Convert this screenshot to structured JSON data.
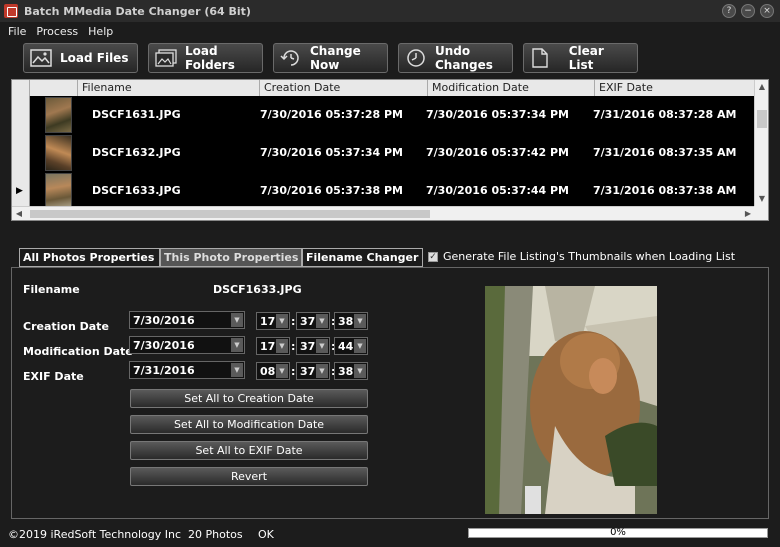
{
  "window": {
    "title": "Batch MMedia Date Changer (64 Bit)",
    "controls": [
      "?",
      "−",
      "×"
    ]
  },
  "menu": [
    "File",
    "Process",
    "Help"
  ],
  "toolbar": {
    "load_files": "Load Files",
    "load_folders": "Load Folders",
    "change_now": "Change Now",
    "undo_changes": "Undo Changes",
    "clear_list": "Clear List"
  },
  "file_list": {
    "columns": [
      "Filename",
      "Creation Date",
      "Modification Date",
      "EXIF Date"
    ],
    "rows": [
      {
        "filename": "DSCF1631.JPG",
        "creation": "7/30/2016 05:37:28 PM",
        "modification": "7/30/2016 05:37:34 PM",
        "exif": "7/31/2016 08:37:28 AM"
      },
      {
        "filename": "DSCF1632.JPG",
        "creation": "7/30/2016 05:37:34 PM",
        "modification": "7/30/2016 05:37:42 PM",
        "exif": "7/31/2016 08:37:35 AM"
      },
      {
        "filename": "DSCF1633.JPG",
        "creation": "7/30/2016 05:37:38 PM",
        "modification": "7/30/2016 05:37:44 PM",
        "exif": "7/31/2016 08:37:38 AM"
      }
    ],
    "current_row_index": 2
  },
  "tabs": [
    "All Photos Properties",
    "This Photo Properties",
    "Filename Changer"
  ],
  "active_tab": "This Photo Properties",
  "generate_thumbnails": {
    "label": "Generate File Listing's Thumbnails when Loading List",
    "checked": true
  },
  "properties": {
    "filename_label": "Filename",
    "filename_value": "DSCF1633.JPG",
    "creation": {
      "label": "Creation Date",
      "date": "7/30/2016",
      "hour": "17",
      "minute": "37",
      "second": "38"
    },
    "modification": {
      "label": "Modification Date",
      "date": "7/30/2016",
      "hour": "17",
      "minute": "37",
      "second": "44"
    },
    "exif": {
      "label": "EXIF Date",
      "date": "7/31/2016",
      "hour": "08",
      "minute": "37",
      "second": "38"
    },
    "buttons": {
      "set_creation": "Set All to Creation Date",
      "set_modification": "Set All to Modification Date",
      "set_exif": "Set All to EXIF Date",
      "revert": "Revert"
    }
  },
  "status": {
    "copyright": "©2019 iRedSoft Technology Inc",
    "count": "20 Photos",
    "state": "OK",
    "progress": "0%"
  },
  "colors": {
    "background": "#1c1c1c",
    "list_bg": "#000000",
    "header_bg": "#e8e8e8"
  }
}
